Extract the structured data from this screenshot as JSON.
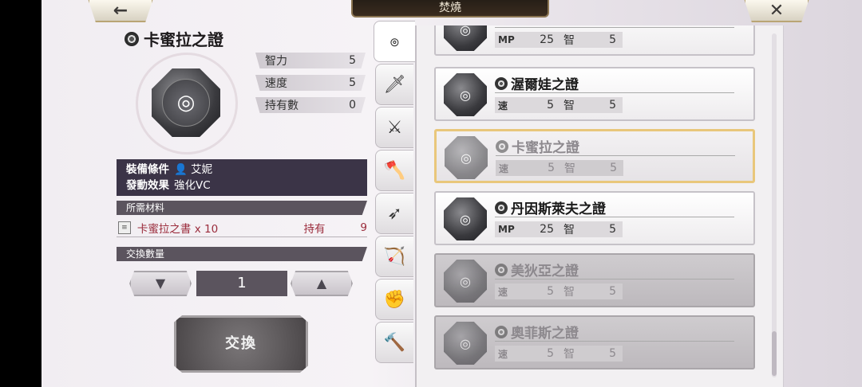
{
  "header": {
    "title": "焚燒",
    "back_icon": "←",
    "close_icon": "✕"
  },
  "item": {
    "name": "卡蜜拉之證",
    "stats": [
      {
        "label": "智力",
        "value": "5"
      },
      {
        "label": "速度",
        "value": "5"
      },
      {
        "label": "持有數",
        "value": "0"
      }
    ],
    "equip_label": "裝備條件",
    "equip_value": "艾妮",
    "effect_label": "發動效果",
    "effect_value": "強化VC"
  },
  "materials": {
    "section_label": "所需材料",
    "name": "卡蜜拉之書 x 10",
    "owned_label": "持有",
    "owned_value": "9"
  },
  "exchange": {
    "section_label": "交換數量",
    "decrease": "▼",
    "quantity": "1",
    "increase": "▲",
    "button_label": "交換"
  },
  "tabs": [
    {
      "icon": "ၜ",
      "name": "scroll-tab"
    },
    {
      "icon": "🗡",
      "name": "sword-tab"
    },
    {
      "icon": "⚔",
      "name": "saber-tab"
    },
    {
      "icon": "🪓",
      "name": "axe-tab"
    },
    {
      "icon": "➶",
      "name": "spear-tab"
    },
    {
      "icon": "🏹",
      "name": "bow-tab"
    },
    {
      "icon": "✊",
      "name": "fist-tab"
    },
    {
      "icon": "🔨",
      "name": "hammer-tab"
    }
  ],
  "list": [
    {
      "name": "",
      "k1": "MP",
      "v1": "25",
      "k2": "智",
      "v2": "5",
      "state": "normal"
    },
    {
      "name": "渥爾娃之證",
      "k1": "速",
      "v1": "5",
      "k2": "智",
      "v2": "5",
      "state": "normal"
    },
    {
      "name": "卡蜜拉之證",
      "k1": "速",
      "v1": "5",
      "k2": "智",
      "v2": "5",
      "state": "sel"
    },
    {
      "name": "丹因斯萊夫之證",
      "k1": "MP",
      "v1": "25",
      "k2": "智",
      "v2": "5",
      "state": "normal"
    },
    {
      "name": "美狄亞之證",
      "k1": "速",
      "v1": "5",
      "k2": "智",
      "v2": "5",
      "state": "dim"
    },
    {
      "name": "奧菲斯之證",
      "k1": "速",
      "v1": "5",
      "k2": "智",
      "v2": "5",
      "state": "dim"
    }
  ]
}
